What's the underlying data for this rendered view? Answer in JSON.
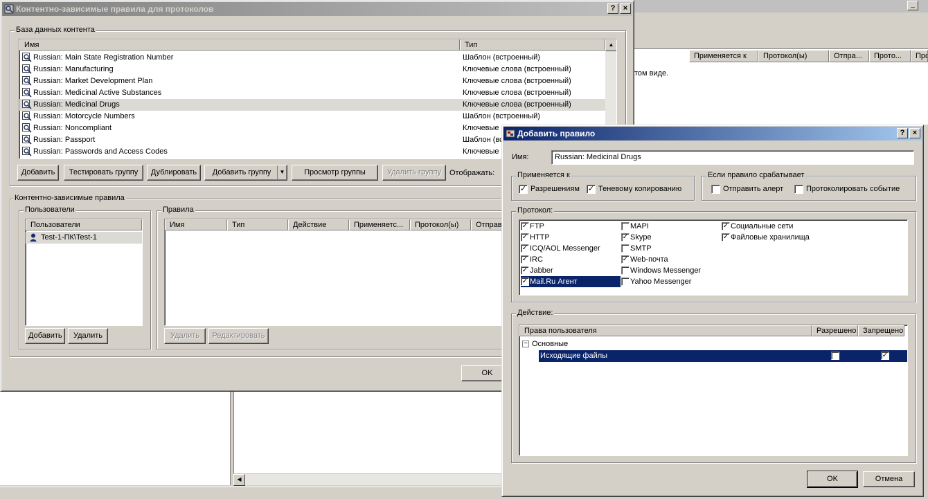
{
  "background": {
    "columns": [
      "Применяется к",
      "Протокол(ы)",
      "Отпра...",
      "Прото...",
      "Про"
    ],
    "text": "том виде.",
    "min_btn": "_"
  },
  "main_window": {
    "title": "Контентно-зависимые правила для протоколов",
    "help_btn": "?",
    "close_btn": "×",
    "content_db": {
      "label": "База данных контента",
      "columns": [
        "Имя",
        "Тип"
      ],
      "rows": [
        {
          "name": "Russian: Main State Registration Number",
          "type": "Шаблон (встроенный)"
        },
        {
          "name": "Russian: Manufacturing",
          "type": "Ключевые слова (встроенный)"
        },
        {
          "name": "Russian: Market Development Plan",
          "type": "Ключевые слова (встроенный)"
        },
        {
          "name": "Russian: Medicinal Active Substances",
          "type": "Ключевые слова (встроенный)"
        },
        {
          "name": "Russian: Medicinal Drugs",
          "type": "Ключевые слова (встроенный)"
        },
        {
          "name": "Russian: Motorcycle Numbers",
          "type": "Шаблон (встроенный)"
        },
        {
          "name": "Russian: Noncompliant",
          "type": "Ключевые"
        },
        {
          "name": "Russian: Passport",
          "type": "Шаблон (вс"
        },
        {
          "name": "Russian: Passwords and Access Codes",
          "type": "Ключевые"
        }
      ],
      "buttons": {
        "add": "Добавить",
        "test_group": "Тестировать группу",
        "duplicate": "Дублировать",
        "add_group": "Добавить группу",
        "view_group": "Просмотр группы",
        "delete_group": "Удалить группу"
      },
      "display_label": "Отображать:"
    },
    "rules": {
      "label": "Контентно-зависимые правила",
      "users": {
        "label": "Пользователи",
        "header": "Пользователи",
        "items": [
          "Test-1-ПК\\Test-1"
        ],
        "add": "Добавить",
        "delete": "Удалить"
      },
      "rules_box": {
        "label": "Правила",
        "columns": [
          "Имя",
          "Тип",
          "Действие",
          "Применяетс...",
          "Протокол(ы)",
          "Отправ"
        ],
        "delete": "Удалить",
        "edit": "Редактировать"
      }
    },
    "ok": "OK"
  },
  "add_rule_dialog": {
    "title": "Добавить правило",
    "help_btn": "?",
    "close_btn": "×",
    "name_label": "Имя:",
    "name_value": "Russian: Medicinal Drugs",
    "applies_to": {
      "label": "Применяется к",
      "items": [
        {
          "label": "Разрешениям",
          "checked": true
        },
        {
          "label": "Теневому копированию",
          "checked": true
        }
      ]
    },
    "if_triggered": {
      "label": "Если правило срабатывает",
      "items": [
        {
          "label": "Отправить алерт",
          "checked": false
        },
        {
          "label": "Протоколировать событие",
          "checked": false
        }
      ]
    },
    "protocol": {
      "label": "Протокол:",
      "col1": [
        {
          "label": "FTP",
          "checked": true
        },
        {
          "label": "HTTP",
          "checked": true
        },
        {
          "label": "ICQ/AOL Messenger",
          "checked": true
        },
        {
          "label": "IRC",
          "checked": true
        },
        {
          "label": "Jabber",
          "checked": true
        },
        {
          "label": "Mail.Ru Агент",
          "checked": true
        }
      ],
      "col2": [
        {
          "label": "MAPI",
          "checked": false
        },
        {
          "label": "Skype",
          "checked": true
        },
        {
          "label": "SMTP",
          "checked": false
        },
        {
          "label": "Web-почта",
          "checked": true
        },
        {
          "label": "Windows Messenger",
          "checked": false
        },
        {
          "label": "Yahoo Messenger",
          "checked": false
        }
      ],
      "col3": [
        {
          "label": "Социальные сети",
          "checked": true
        },
        {
          "label": "Файловые хранилища",
          "checked": true
        }
      ]
    },
    "action": {
      "label": "Действие:",
      "columns": [
        "Права пользователя",
        "Разрешено",
        "Запрещено"
      ],
      "group": "Основные",
      "expander": "−",
      "rows": [
        {
          "label": "Исходящие файлы",
          "allowed": false,
          "denied": true
        }
      ]
    },
    "ok": "OK",
    "cancel": "Отмена"
  },
  "colors": {
    "face": "#d4d0c8",
    "active_title": "#0a246a",
    "selection": "#0a246a"
  }
}
